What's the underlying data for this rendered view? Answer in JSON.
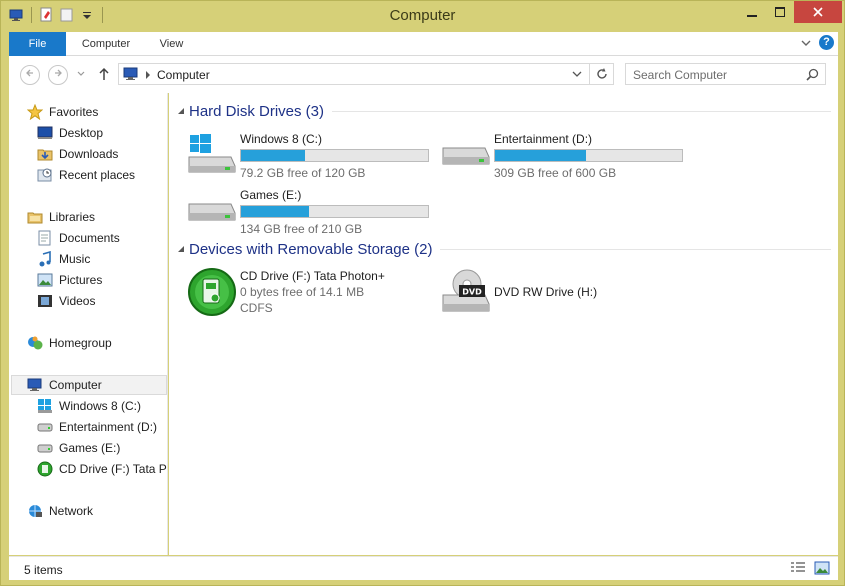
{
  "window": {
    "title": "Computer"
  },
  "ribbon": {
    "tabs": [
      "File",
      "Computer",
      "View"
    ]
  },
  "address": {
    "location": "Computer",
    "search_placeholder": "Search Computer"
  },
  "nav": {
    "favorites": {
      "label": "Favorites",
      "items": [
        "Desktop",
        "Downloads",
        "Recent places"
      ]
    },
    "libraries": {
      "label": "Libraries",
      "items": [
        "Documents",
        "Music",
        "Pictures",
        "Videos"
      ]
    },
    "homegroup": "Homegroup",
    "computer": {
      "label": "Computer",
      "items": [
        "Windows 8 (C:)",
        "Entertainment (D:)",
        "Games (E:)",
        "CD Drive (F:) Tata Photon+"
      ]
    },
    "network": "Network"
  },
  "groups": {
    "hdd": "Hard Disk Drives (3)",
    "removable": "Devices with Removable Storage (2)"
  },
  "drives": [
    {
      "name": "Windows 8 (C:)",
      "free": "79.2 GB free of 120 GB",
      "used_fraction": 0.34
    },
    {
      "name": "Entertainment (D:)",
      "free": "309 GB free of 600 GB",
      "used_fraction": 0.485
    },
    {
      "name": "Games (E:)",
      "free": "134 GB free of 210 GB",
      "used_fraction": 0.362
    }
  ],
  "removable": [
    {
      "name": "CD Drive (F:) Tata Photon+",
      "free": "0 bytes free of 14.1 MB",
      "fs": "CDFS"
    },
    {
      "name": "DVD RW Drive (H:)"
    }
  ],
  "status": {
    "count": "5 items"
  },
  "colors": {
    "accent": "#1979ca",
    "bar_fill": "#26a0da",
    "group_title": "#1e3287",
    "frame": "#d6d078",
    "close": "#c7463f"
  },
  "icons": {
    "dvd_label": "DVD"
  }
}
